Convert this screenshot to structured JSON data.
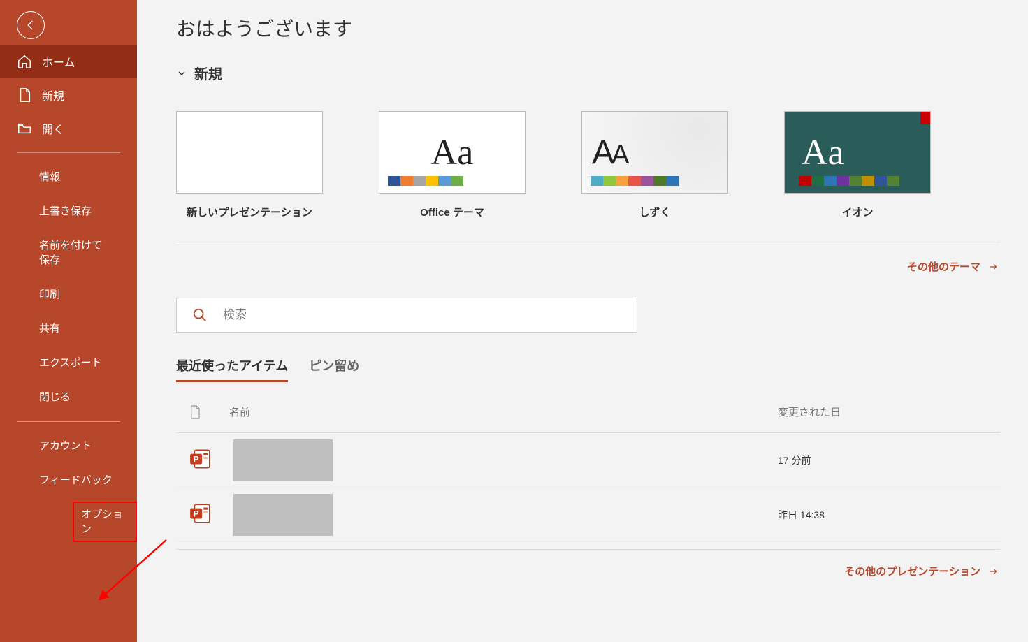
{
  "sidebar": {
    "home": "ホーム",
    "new": "新規",
    "open": "開く",
    "info": "情報",
    "save": "上書き保存",
    "saveas": "名前を付けて保存",
    "print": "印刷",
    "share": "共有",
    "export": "エクスポート",
    "close": "閉じる",
    "account": "アカウント",
    "feedback": "フィードバック",
    "options": "オプション"
  },
  "main": {
    "greeting": "おはようございます",
    "newSection": "新規",
    "templates": {
      "blank": "新しいプレゼンテーション",
      "office": "Office テーマ",
      "shizuku": "しずく",
      "ion": "イオン"
    },
    "moreThemes": "その他のテーマ",
    "searchPlaceholder": "検索",
    "tabs": {
      "recent": "最近使ったアイテム",
      "pinned": "ピン留め"
    },
    "columns": {
      "name": "名前",
      "modified": "変更された日"
    },
    "rows": [
      {
        "date": "17 分前"
      },
      {
        "date": "昨日 14:38"
      }
    ],
    "morePresentations": "その他のプレゼンテーション"
  }
}
